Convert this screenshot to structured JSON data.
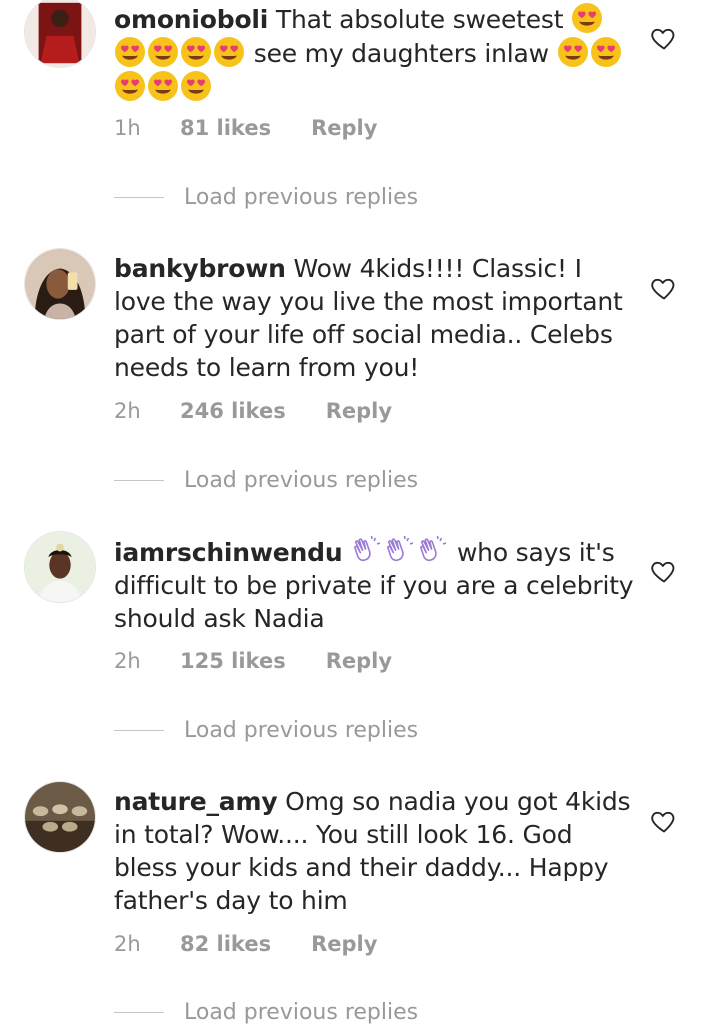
{
  "comments": [
    {
      "username": "omonioboli",
      "text_before": "That absolute sweetest",
      "text_mid": "see my daughters inlaw",
      "emojis_a": [
        "heart-eyes-emoji"
      ],
      "emojis_b": [
        "heart-eyes-emoji",
        "heart-eyes-emoji",
        "heart-eyes-emoji",
        "heart-eyes-emoji"
      ],
      "emojis_c": [
        "heart-eyes-emoji",
        "heart-eyes-emoji"
      ],
      "emojis_d": [
        "heart-eyes-emoji",
        "heart-eyes-emoji",
        "heart-eyes-emoji"
      ],
      "time": "1h",
      "likes": "81 likes",
      "reply": "Reply",
      "load_replies": "Load previous replies"
    },
    {
      "username": "bankybrown",
      "text": "Wow 4kids!!!! Classic! I love the way you live the most important part of your life off social media.. Celebs needs to learn from you!",
      "time": "2h",
      "likes": "246 likes",
      "reply": "Reply",
      "load_replies": "Load previous replies"
    },
    {
      "username": "iamrschinwendu",
      "emojis": [
        "clapping-hands-emoji",
        "clapping-hands-emoji",
        "clapping-hands-emoji"
      ],
      "text": "who says it's difficult to be private if you are a celebrity should ask Nadia",
      "time": "2h",
      "likes": "125 likes",
      "reply": "Reply",
      "load_replies": "Load previous replies"
    },
    {
      "username": "nature_amy",
      "text": "Omg so nadia you got 4kids in total? Wow.... You still look 16. God bless your kids and their daddy... Happy father's day to him",
      "time": "2h",
      "likes": "82 likes",
      "reply": "Reply",
      "load_replies": "Load previous replies"
    }
  ],
  "colors": {
    "text": "#262626",
    "muted": "#999999",
    "divider": "#c7c7c7",
    "emoji_yellow": "#f7c31a",
    "emoji_heart": "#e63c6f"
  },
  "icons": {
    "like": "heart-outline-icon"
  }
}
